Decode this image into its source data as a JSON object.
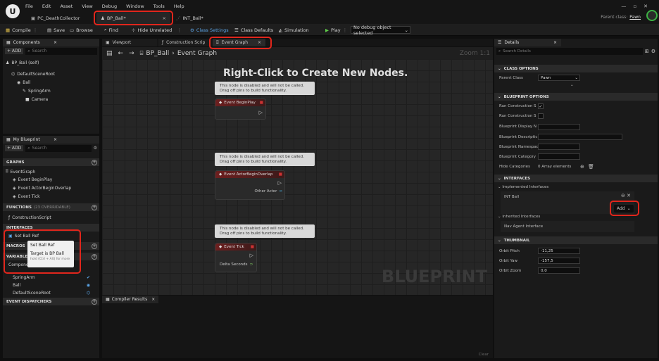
{
  "menu": [
    "File",
    "Edit",
    "Asset",
    "View",
    "Debug",
    "Window",
    "Tools",
    "Help"
  ],
  "tabs": [
    {
      "label": "PC_DeathCollector"
    },
    {
      "label": "BP_Ball*"
    },
    {
      "label": "INT_Ball*"
    }
  ],
  "parent_class": {
    "label": "Parent class:",
    "value": "Pawn"
  },
  "toolbar": {
    "compile": "Compile",
    "save": "Save",
    "browse": "Browse",
    "find": "Find",
    "hide_unrelated": "Hide Unrelated",
    "class_settings": "Class Settings",
    "class_defaults": "Class Defaults",
    "simulation": "Simulation",
    "play": "Play",
    "debug_select": "No debug object selected"
  },
  "components": {
    "title": "Components",
    "add": "+ ADD",
    "search": "Search",
    "self": "BP_Ball (self)",
    "items": [
      "DefaultSceneRoot",
      "Ball",
      "SpringArm",
      "Camera"
    ]
  },
  "my_blueprint": {
    "title": "My Blueprint",
    "add": "+ ADD",
    "search": "Search",
    "graphs": "GRAPHS",
    "event_graph": "EventGraph",
    "events": [
      "Event BeginPlay",
      "Event ActorBeginOverlap",
      "Event Tick"
    ],
    "functions": "FUNCTIONS",
    "functions_count": "(23 OVERRIDABLE)",
    "construction": "ConstructionScript",
    "interfaces": "INTERFACES",
    "set_ball_ref": "Set Ball Ref",
    "macros": "MACROS",
    "variables": "VARIABLES",
    "components_label": "Components",
    "vars": [
      "SpringArm",
      "Ball",
      "DefaultSceneRoot"
    ],
    "event_dispatchers": "EVENT DISPATCHERS",
    "tooltip": {
      "title": "Set Ball Ref",
      "target": "Target is BP Ball",
      "hint": "hold (Ctrl + Alt) for more"
    }
  },
  "editor_tabs": {
    "viewport": "Viewport",
    "construction": "Construction Scrip",
    "event_graph": "Event Graph"
  },
  "graph": {
    "breadcrumb_bp": "BP_Ball",
    "breadcrumb_graph": "Event Graph",
    "zoom": "Zoom 1:1",
    "hint": "Right-Click to Create New Nodes.",
    "watermark": "BLUEPRINT",
    "comment_l1": "This node is disabled and will not be called.",
    "comment_l2": "Drag off pins to build functionality.",
    "nodes": [
      "Event BeginPlay",
      "Event ActorBeginOverlap",
      "Event Tick"
    ],
    "other_actor": "Other Actor",
    "delta_seconds": "Delta Seconds"
  },
  "compiler": {
    "title": "Compiler Results",
    "clear": "Clear"
  },
  "details": {
    "title": "Details",
    "search": "Search Details",
    "class_options": "CLASS OPTIONS",
    "parent_class": "Parent Class",
    "parent_value": "Pawn",
    "bp_options": "BLUEPRINT OPTIONS",
    "run1": "Run Construction S",
    "run2": "Run Construction S",
    "display": "Blueprint Display N",
    "desc": "Blueprint Descriptic",
    "namespace": "Blueprint Namespac",
    "category": "Blueprint Category",
    "hide": "Hide Categories",
    "hide_value": "0 Array elements",
    "interfaces": "INTERFACES",
    "implemented": "Implemented Interfaces",
    "int_ball": "INT Ball",
    "add": "Add",
    "inherited": "Inherited Interfaces",
    "nav": "Nav Agent Interface",
    "thumbnail": "THUMBNAIL",
    "pitch_label": "Orbit Pitch",
    "pitch": "-11,25",
    "yaw_label": "Orbit Yaw",
    "yaw": "-157,5",
    "zoom_label": "Orbit Zoom",
    "zoom_val": "0,0"
  },
  "colors": {
    "accent_red": "#e1261c",
    "event_node": "#6d1f1f",
    "link_blue": "#5ba4e6"
  }
}
